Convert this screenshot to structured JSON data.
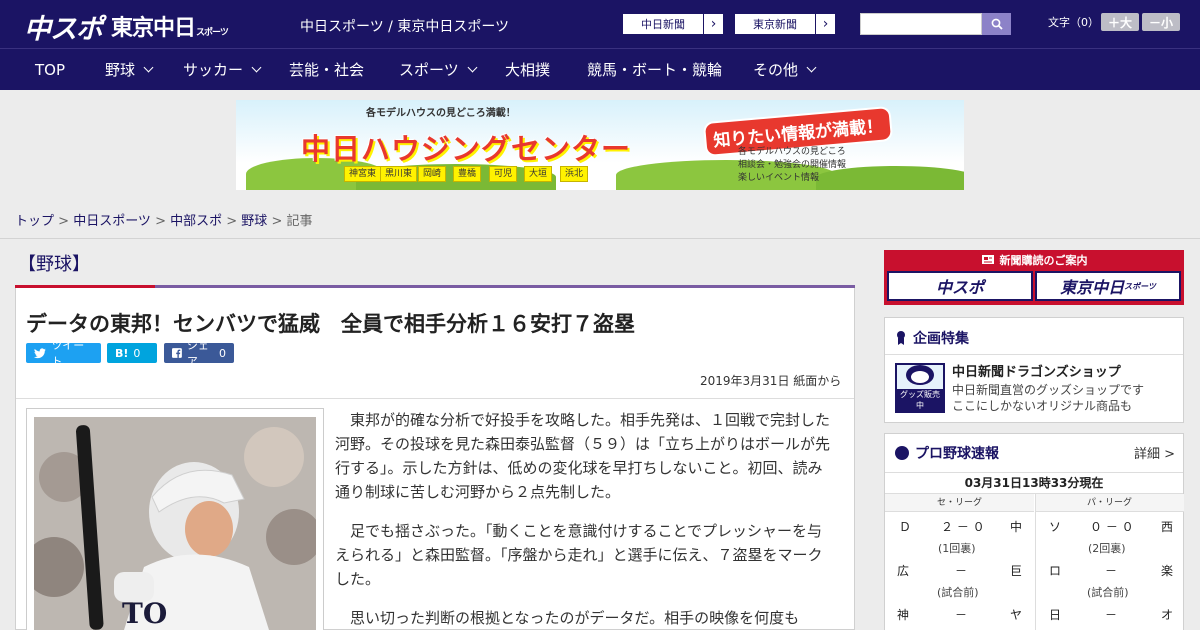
{
  "header": {
    "logo_chuspo": "中スポ",
    "logo_tokyo": "東京中日",
    "logo_tokyo_small": "スポーツ",
    "site_names": "中日スポーツ / 東京中日スポーツ",
    "chunichi_link": "中日新聞",
    "tokyo_link": "東京新聞",
    "search_placeholder": "",
    "font_size_label": "文字（0）",
    "font_larger": "＋大",
    "font_smaller": "－小"
  },
  "nav": {
    "items": [
      "TOP",
      "野球",
      "サッカー",
      "芸能・社会",
      "スポーツ",
      "大相撲",
      "競馬・ボート・競輪",
      "その他"
    ]
  },
  "ad": {
    "top_text": "各モデルハウスの見どころ満載！",
    "title": "中日ハウジングセンター",
    "right_tag": "知りたい情報が満載！",
    "bullets": [
      "各モデルハウスの見どころ",
      "相談会・勉強会の開催情報",
      "楽しいイベント情報"
    ],
    "cities": [
      "神宮東",
      "黒川東",
      "岡崎",
      "豊橋",
      "可児",
      "大垣",
      "浜北"
    ]
  },
  "breadcrumb": {
    "items": [
      "トップ",
      "中日スポーツ",
      "中部スポ",
      "野球"
    ],
    "current": "記事",
    "separator": " > "
  },
  "article": {
    "section": "【野球】",
    "headline": "データの東邦！センバツで猛威　全員で相手分析１６安打７盗塁",
    "tweet_label": "ツイート",
    "hatena_label": "B!",
    "hatena_count": "0",
    "facebook_label": "シェア",
    "facebook_count": "0",
    "date": "2019年3月31日 紙面から",
    "paragraphs": [
      "東邦が的確な分析で好投手を攻略した。相手先発は、１回戦で完封した河野。その投球を見た森田泰弘監督（５９）は「立ち上がりはボールが先行する」。示した方針は、低めの変化球を早打ちしないこと。初回、読み通り制球に苦しむ河野から２点先制した。",
      "足でも揺さぶった。「動くことを意識付けすることでプレッシャーを与えられる」と森田監督。「序盤から走れ」と選手に伝え、７盗塁をマークした。",
      "思い切った判断の根拠となったのがデータだ。相手の映像を何度も"
    ],
    "photo_jersey": "TO"
  },
  "sidebar": {
    "subscribe_title": "新聞購読のご案内",
    "sub_logo_1": "中スポ",
    "sub_logo_2": "東京中日",
    "sub_logo_2_small": "スポーツ",
    "feature_title": "企画特集",
    "shop_tag": "グッズ販売中",
    "shop_title": "中日新聞ドラゴンズショップ",
    "shop_desc_1": "中日新聞直営のグッズショップです",
    "shop_desc_2": "ここにしかないオリジナル商品も",
    "scores_title": "プロ野球速報",
    "scores_more": "詳細 >",
    "scores_time": "03月31日13時33分現在",
    "central_league": "セ・リーグ",
    "pacific_league": "パ・リーグ",
    "central_games": [
      {
        "home": "Ｄ",
        "score": "２ － ０",
        "away": "中",
        "status": "(1回裏)"
      },
      {
        "home": "広",
        "score": "－",
        "away": "巨",
        "status": "(試合前)"
      },
      {
        "home": "神",
        "score": "－",
        "away": "ヤ",
        "status": ""
      }
    ],
    "pacific_games": [
      {
        "home": "ソ",
        "score": "０ － ０",
        "away": "西",
        "status": "(2回裏)"
      },
      {
        "home": "ロ",
        "score": "－",
        "away": "楽",
        "status": "(試合前)"
      },
      {
        "home": "日",
        "score": "－",
        "away": "オ",
        "status": ""
      }
    ]
  },
  "colors": {
    "navy": "#1b1464",
    "red": "#c8102e",
    "purple": "#7a5ca3",
    "twitter": "#1da1f2",
    "hatena": "#00a4de",
    "facebook": "#3b5998"
  }
}
